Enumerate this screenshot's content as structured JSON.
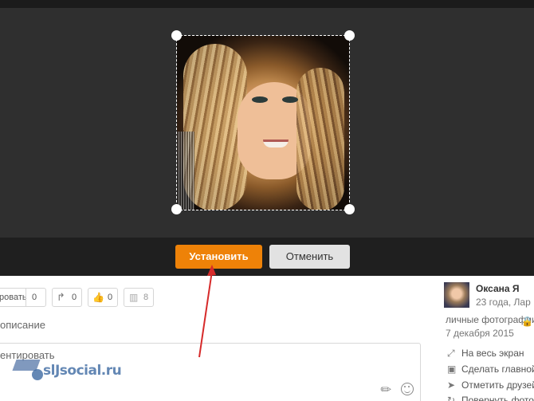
{
  "editor": {
    "set_button": "Установить",
    "cancel_button": "Отменить"
  },
  "actions": {
    "share_label": "ровать",
    "share_count": "0",
    "reshare_count": "0",
    "like_count": "0",
    "stats_count": "8"
  },
  "description_label": "описание",
  "comment_label": "ентировать",
  "watermark_text": "slJsocial.ru",
  "sidebar": {
    "user_name": "Оксана Я",
    "user_meta": "23 года, Лар",
    "album": "личные фотографии",
    "date": "7 декабря 2015",
    "links": [
      {
        "label": "На весь экран",
        "icon": "fullscreen-icon"
      },
      {
        "label": "Сделать главной",
        "icon": "avatar-icon"
      },
      {
        "label": "Отметить друзей",
        "icon": "tag-pointer-icon"
      },
      {
        "label": "Повернуть фото",
        "icon": "rotate-icon"
      }
    ]
  },
  "colors": {
    "accent": "#ee8208",
    "editor_bg": "#2f2f2f",
    "toolbar_bg": "#1f1f1f"
  }
}
